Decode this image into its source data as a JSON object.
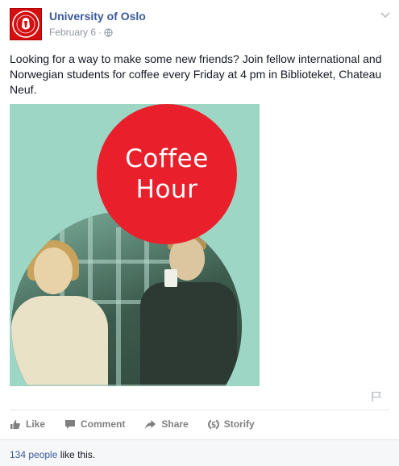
{
  "post": {
    "page_name": "University of Oslo",
    "date": "February 6",
    "separator": "·",
    "text": "Looking for a way to make some new friends? Join fellow international and Norwegian students for coffee every Friday at 4 pm in Biblioteket, Chateau Neuf.",
    "image": {
      "line1": "Coffee",
      "line2": "Hour"
    }
  },
  "actions": {
    "like": "Like",
    "comment": "Comment",
    "share": "Share",
    "storify": "Storify"
  },
  "likes": {
    "link": "134 people",
    "suffix": " like this."
  },
  "colors": {
    "brand_blue": "#3b5998",
    "logo_red": "#d40f0f",
    "circle_red": "#e9202c",
    "image_teal": "#9ed6c5"
  },
  "icons": [
    "university-logo-icon",
    "globe-icon",
    "chevron-down-icon",
    "flag-icon",
    "like-icon",
    "comment-icon",
    "share-icon",
    "storify-icon"
  ]
}
